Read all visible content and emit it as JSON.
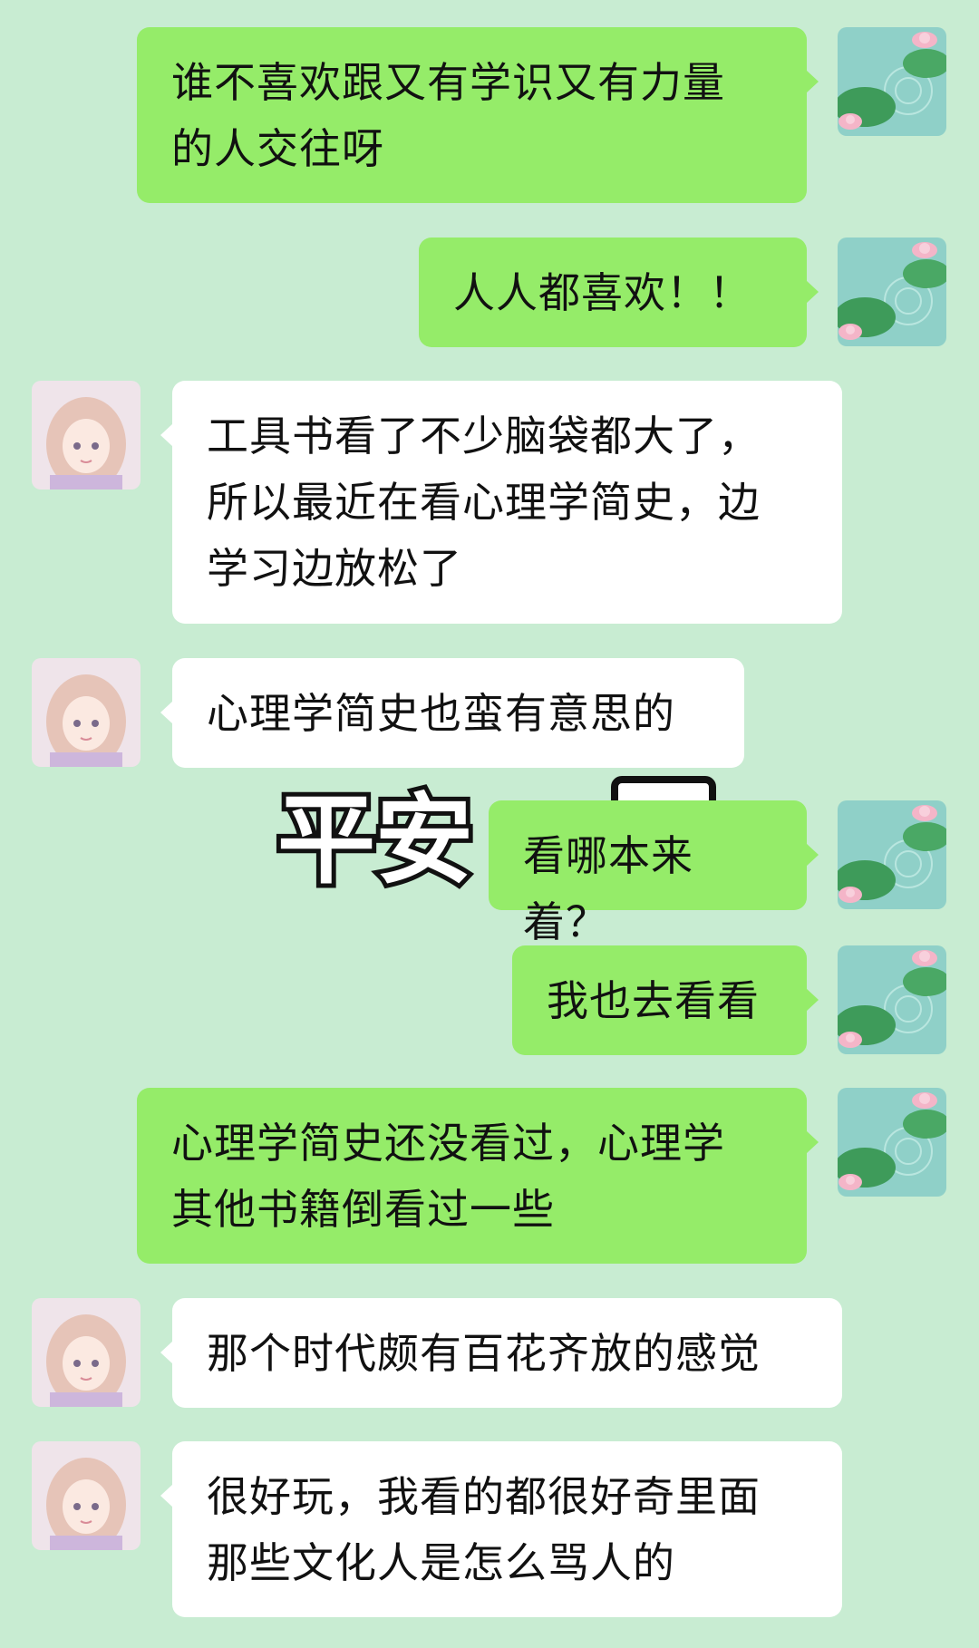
{
  "colors": {
    "background": "#c8ecd2",
    "my_bubble": "#95ec69",
    "other_bubble": "#ffffff"
  },
  "sticker": {
    "text": "平安"
  },
  "messages": [
    {
      "sender": "me",
      "avatar": "lotus-pond-avatar",
      "text": "谁不喜欢跟又有学识又有力量\n的人交往呀"
    },
    {
      "sender": "me",
      "avatar": "lotus-pond-avatar",
      "text": "人人都喜欢！！"
    },
    {
      "sender": "other",
      "avatar": "anime-girl-avatar",
      "text": "工具书看了不少脑袋都大了，\n所以最近在看心理学简史，边\n学习边放松了"
    },
    {
      "sender": "other",
      "avatar": "anime-girl-avatar",
      "text": "心理学简史也蛮有意思的"
    },
    {
      "sender": "me",
      "avatar": "lotus-pond-avatar",
      "text": "看哪本来着？"
    },
    {
      "sender": "me",
      "avatar": "lotus-pond-avatar",
      "text": "我也去看看"
    },
    {
      "sender": "me",
      "avatar": "lotus-pond-avatar",
      "text": "心理学简史还没看过，心理学\n其他书籍倒看过一些"
    },
    {
      "sender": "other",
      "avatar": "anime-girl-avatar",
      "text": "那个时代颇有百花齐放的感觉"
    },
    {
      "sender": "other",
      "avatar": "anime-girl-avatar",
      "text": "很好玩，我看的都很好奇里面\n那些文化人是怎么骂人的"
    }
  ]
}
